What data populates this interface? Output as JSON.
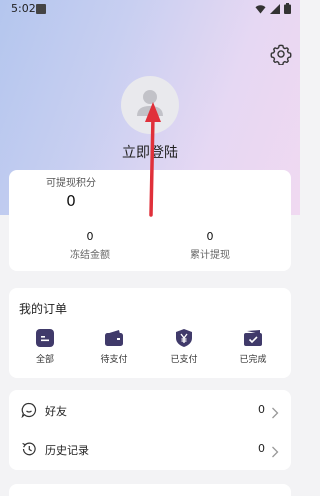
{
  "status": {
    "time": "5:02"
  },
  "profile": {
    "login_label": "立即登陆"
  },
  "points": {
    "available_label": "可提现积分",
    "available_value": "0",
    "frozen_value": "0",
    "frozen_label": "冻结金额",
    "cumulative_value": "0",
    "cumulative_label": "累计提现"
  },
  "orders": {
    "title": "我的订单",
    "items": [
      {
        "label": "全部",
        "icon": "all-orders-icon"
      },
      {
        "label": "待支付",
        "icon": "wallet-icon"
      },
      {
        "label": "已支付",
        "icon": "yen-shield-icon"
      },
      {
        "label": "已完成",
        "icon": "completed-folder-icon"
      }
    ]
  },
  "menu": {
    "items": [
      {
        "label": "好友",
        "count": "0",
        "icon": "chat-icon"
      },
      {
        "label": "历史记录",
        "count": "0",
        "icon": "history-icon"
      }
    ]
  },
  "colors": {
    "accent": "#403a6a",
    "annotation_arrow": "#e0303a"
  }
}
